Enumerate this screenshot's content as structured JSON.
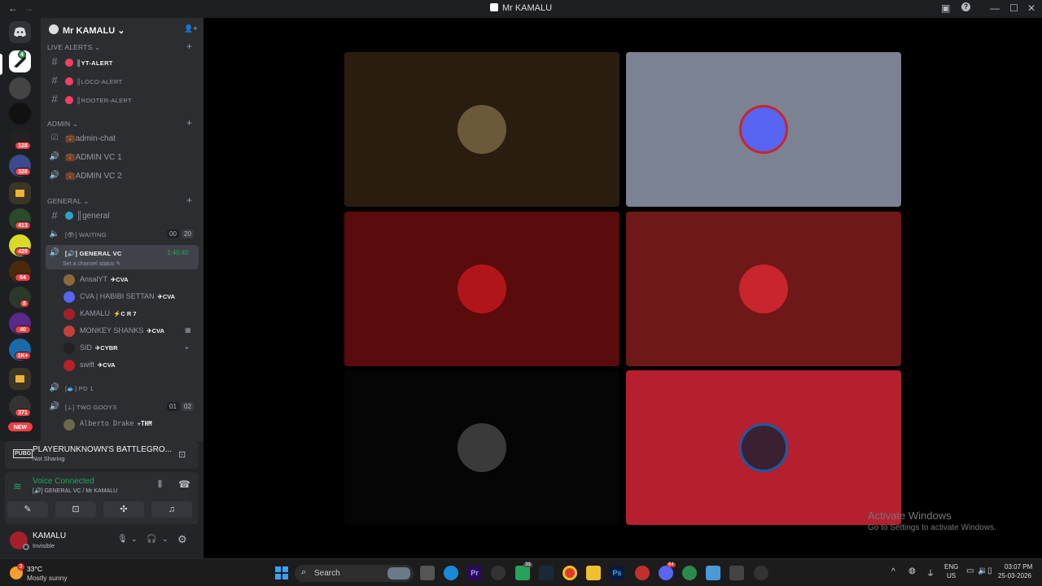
{
  "window": {
    "title": "Mr KAMALU",
    "back_glyph": "←",
    "forward_glyph": "→",
    "controls": {
      "inbox": "▣",
      "help": "?",
      "minimize": "—",
      "maximize": "☐",
      "close": "✕"
    }
  },
  "guild_badges": {
    "g1": "4",
    "g2": "128",
    "g3": "328",
    "g4": "413",
    "g5": "429",
    "g6": "64",
    "g7": "8",
    "g8": "40",
    "g9": "1K+",
    "g10": "371",
    "new": "NEW"
  },
  "server": {
    "name": "Mr KAMALU ⌄",
    "categories": {
      "live_alerts": "LIVE ALERTS ⌄",
      "admin": "ADMIN ⌄",
      "general": "GENERAL ⌄"
    },
    "channels": {
      "yt_alert": "║YT-ALERT",
      "loco_alert": "║LOCO-ALERT",
      "rooter_alert": "║ROOTER-ALERT",
      "admin_chat": "💼admin-chat",
      "admin_vc1": "💼ADMIN VC 1",
      "admin_vc2": "💼ADMIN VC 2",
      "general": "║general",
      "waiting": "[👁] WAITING",
      "waiting_count_a": "00",
      "waiting_count_b": "20",
      "general_vc": "[🔊] GENERAL VC",
      "general_vc_timer": "1:40:40",
      "set_status": "Set a channel status ✎",
      "pd1": "[🐟] PD 1",
      "two_gooys": "[⊥] TWO GOOYS",
      "two_gooys_a": "01",
      "two_gooys_b": "02"
    },
    "members": [
      {
        "name": "AnsalYT",
        "tag": "✈CVA",
        "color": "#8a6a3a"
      },
      {
        "name": "CVA | HABIBI SETTAN",
        "tag": "✈CVA",
        "color": "#5865f2"
      },
      {
        "name": "KAMALU",
        "tag": "⚡C R 7",
        "color": "#a3202a"
      },
      {
        "name": "MONKEY SHANKS",
        "tag": "✈CVA",
        "color": "#c4403a"
      },
      {
        "name": "SID",
        "tag": "✈CYBR",
        "color": "#222"
      },
      {
        "name": "swift",
        "tag": "✈CVA",
        "color": "#b8202a"
      }
    ],
    "two_gooys_member": {
      "name": "Alberto Drake",
      "tag": "✈THM"
    }
  },
  "activity": {
    "game": "PLAYERUNKNOWN'S BATTLEGRO...",
    "status": "Not Sharing",
    "game_icon": "PUBG"
  },
  "voice": {
    "status": "Voice Connected",
    "location": "[🔊] GENERAL VC / Mr KAMALU"
  },
  "user": {
    "name": "KAMALU",
    "status": "Invisible"
  },
  "voice_icons": {
    "camera_off": "✎",
    "share_screen": "⊡",
    "activities": "✣",
    "soundboard": "♫",
    "signal": "≋",
    "noise": "⫴",
    "disconnect": "☎",
    "mic": "🎙",
    "headset": "🎧",
    "settings": "⚙",
    "chevron": "⌄",
    "add_member": "👤+",
    "screen_share_small": "⊡"
  },
  "tiles": [
    {
      "bg": "#2a1d10",
      "av": "#6b5a3a"
    },
    {
      "bg": "#7b8291",
      "av": "#5865f2"
    },
    {
      "bg": "#5a0b0b",
      "av": "#b0151a"
    },
    {
      "bg": "#6e1818",
      "av": "#c9252c"
    },
    {
      "bg": "#050505",
      "av": "#3a3a3a"
    },
    {
      "bg": "#b51f2e",
      "av": "#3a2030"
    }
  ],
  "watermark": {
    "line1": "Activate Windows",
    "line2": "Go to Settings to activate Windows."
  },
  "taskbar": {
    "weather_temp": "33°C",
    "weather_desc": "Mostly sunny",
    "weather_badge": "3",
    "search_placeholder": "Search",
    "whatsapp_badge": "39",
    "discord_badge": "64",
    "lang": "ENG",
    "region": "US",
    "time": "03:07 PM",
    "date": "25-03-2026"
  }
}
